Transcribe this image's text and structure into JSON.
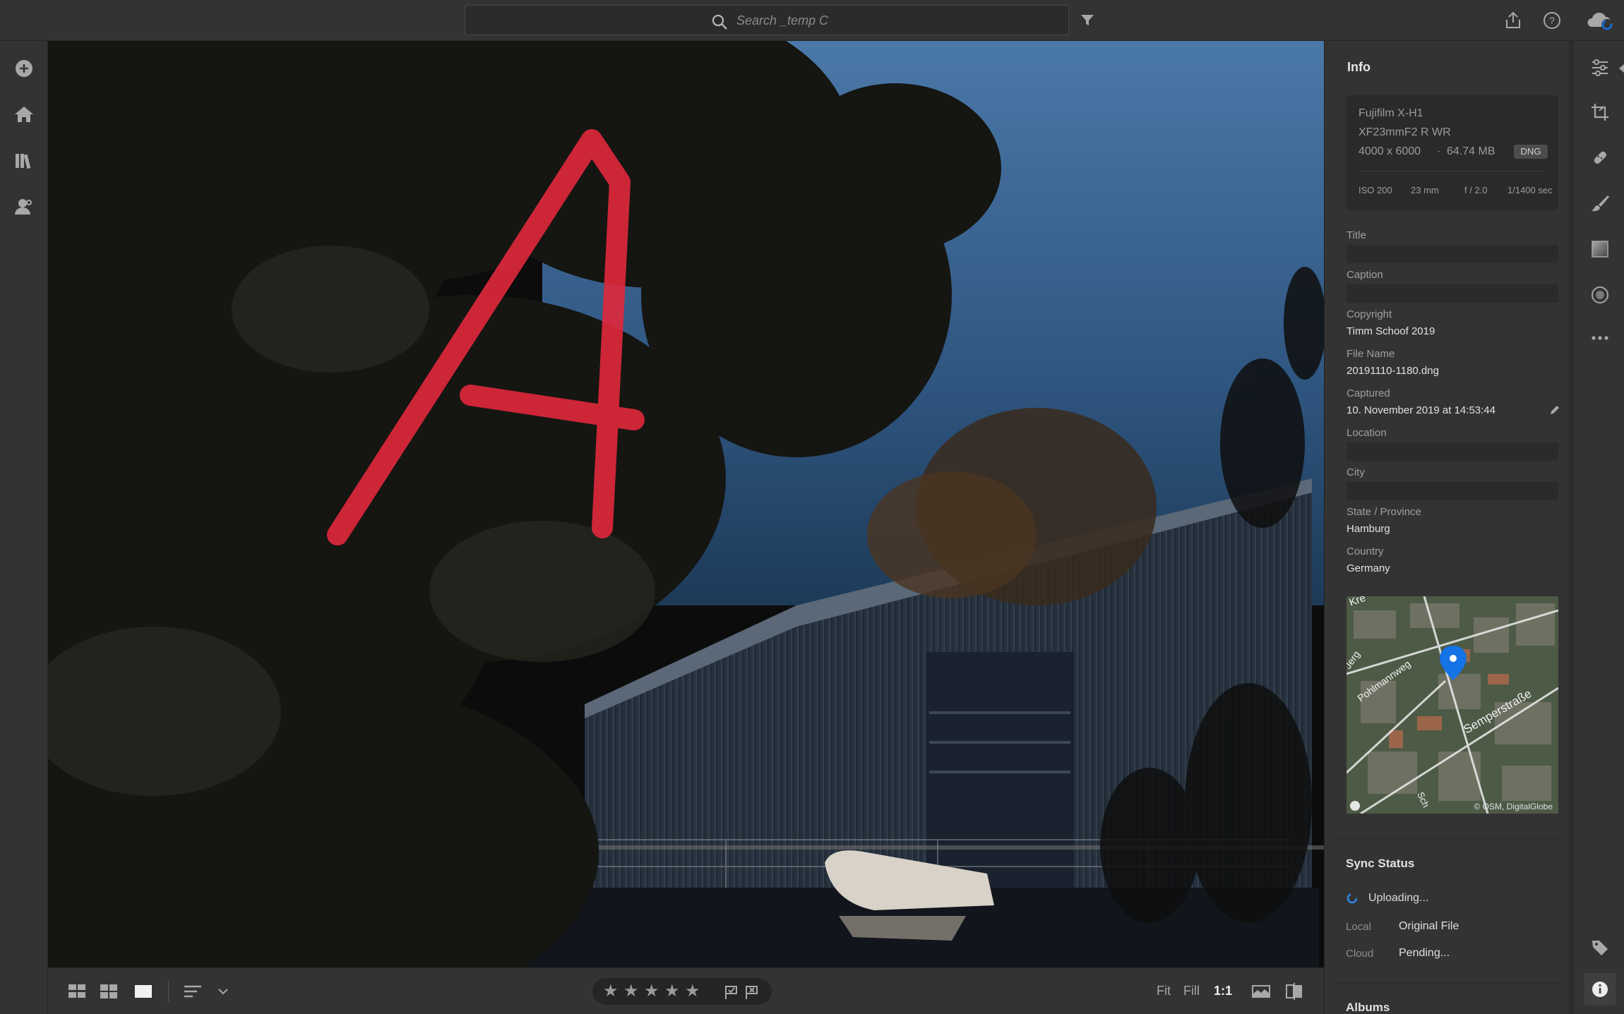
{
  "search": {
    "placeholder": "Search _temp C"
  },
  "topbar": {
    "icons": [
      "search-icon",
      "filter-icon",
      "share-icon",
      "help-icon",
      "cloud-sync-icon"
    ]
  },
  "leftrail": {
    "icons": [
      "add-photos-icon",
      "home-icon",
      "library-icon",
      "people-icon"
    ]
  },
  "bottombar": {
    "view_icons": [
      "square-grid-icon",
      "photo-grid-icon",
      "detail-view-icon",
      "sort-icon",
      "chevron-down-icon"
    ],
    "rating_stars": 5,
    "flags": [
      "pick-flag-icon",
      "reject-flag-icon"
    ],
    "zoom": {
      "fit": "Fit",
      "fill": "Fill",
      "one_to_one": "1:1"
    },
    "right_icons": [
      "before-after-icon",
      "compare-icon"
    ]
  },
  "info": {
    "title": "Info",
    "camera": "Fujifilm X-H1",
    "lens": "XF23mmF2 R WR",
    "dimensions": "4000 x 6000",
    "dot": "·",
    "filesize": "64.74 MB",
    "format": "DNG",
    "iso": "ISO 200",
    "focal": "23 mm",
    "aperture": "f / 2.0",
    "shutter": "1/1400 sec",
    "fields": {
      "title_label": "Title",
      "title_value": "",
      "caption_label": "Caption",
      "caption_value": "",
      "copyright_label": "Copyright",
      "copyright_value": "Timm Schoof 2019",
      "filename_label": "File Name",
      "filename_value": "20191110-1180.dng",
      "captured_label": "Captured",
      "captured_value": "10. November 2019 at 14:53:44",
      "location_label": "Location",
      "location_value": "",
      "city_label": "City",
      "city_value": "",
      "state_label": "State / Province",
      "state_value": "Hamburg",
      "country_label": "Country",
      "country_value": "Germany"
    },
    "map": {
      "streets": [
        "Kre",
        "Jerg",
        "Pohlmannweg",
        "Semperstraße",
        "Sch"
      ],
      "attribution": "© OSM, DigitalGlobe"
    },
    "sync": {
      "title": "Sync Status",
      "status": "Uploading...",
      "local_label": "Local",
      "local_value": "Original File",
      "cloud_label": "Cloud",
      "cloud_value": "Pending..."
    },
    "albums_title": "Albums"
  },
  "rightrail": {
    "icons": [
      "edit-sliders-icon",
      "crop-icon",
      "healing-icon",
      "brush-icon",
      "linear-gradient-icon",
      "radial-gradient-icon",
      "more-icon",
      "keyword-tag-icon",
      "info-icon"
    ]
  },
  "photo": {
    "annotation": "A"
  }
}
